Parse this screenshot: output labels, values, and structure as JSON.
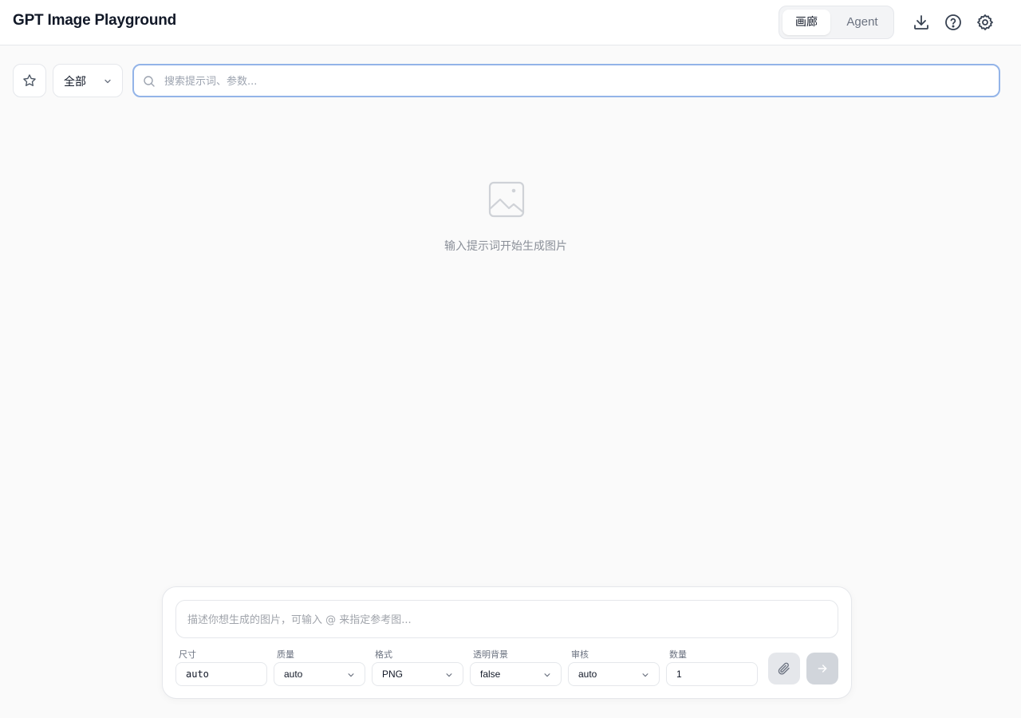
{
  "header": {
    "title": "GPT Image Playground",
    "tabs": [
      {
        "label": "画廊",
        "active": true
      },
      {
        "label": "Agent",
        "active": false
      }
    ],
    "icons": [
      "download-icon",
      "help-icon",
      "settings-icon"
    ]
  },
  "toolbar": {
    "favorites_icon": "star-icon",
    "filter_value": "全部",
    "search_placeholder": "搜索提示词、参数...",
    "search_value": ""
  },
  "empty_state": {
    "icon": "image-placeholder-icon",
    "message": "输入提示词开始生成图片"
  },
  "composer": {
    "prompt_placeholder": "描述你想生成的图片，可输入 @ 来指定参考图...",
    "prompt_value": "",
    "params": [
      {
        "label": "尺寸",
        "value": "auto",
        "type": "input"
      },
      {
        "label": "质量",
        "value": "auto",
        "type": "select"
      },
      {
        "label": "格式",
        "value": "PNG",
        "type": "select"
      },
      {
        "label": "透明背景",
        "value": "false",
        "type": "select"
      },
      {
        "label": "审核",
        "value": "auto",
        "type": "select"
      },
      {
        "label": "数量",
        "value": "1",
        "type": "input"
      }
    ],
    "attach_icon": "paperclip-icon",
    "send_icon": "arrow-right-icon"
  },
  "colors": {
    "background": "#fafafa",
    "accent_border": "#93b4e8",
    "muted_text": "#9ca3af"
  }
}
